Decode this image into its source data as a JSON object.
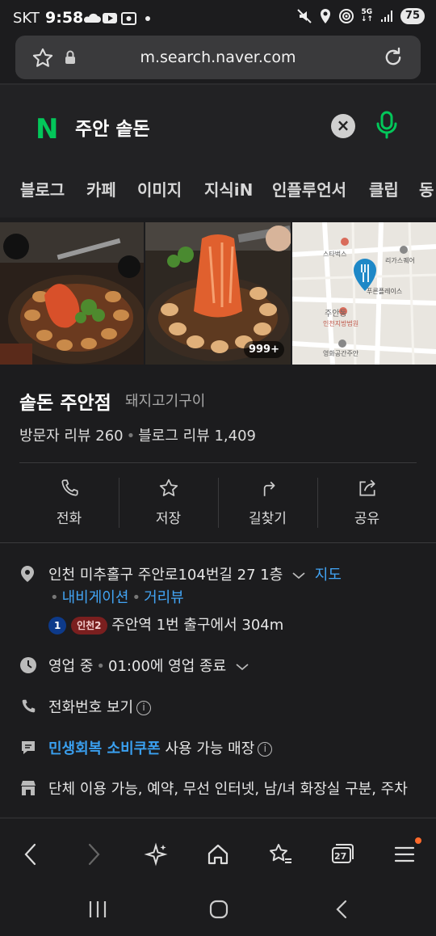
{
  "status_bar": {
    "carrier": "SKT",
    "time": "9:58",
    "battery": "75",
    "network": "5G"
  },
  "browser": {
    "url": "m.search.naver.com"
  },
  "search": {
    "logo": "N",
    "query": "주안 솥돈"
  },
  "tabs": [
    "블로그",
    "카페",
    "이미지",
    "지식iN",
    "인플루언서",
    "클립",
    "동"
  ],
  "gallery": {
    "more_count": "999+",
    "map_labels": [
      "스타벅스",
      "리가스퀘어",
      "주안동",
      "인천지방법원",
      "영화공간주안",
      "푸른플레이스"
    ]
  },
  "place": {
    "name": "솥돈 주안점",
    "category": "돼지고기구이",
    "visitor_reviews": "방문자 리뷰 260",
    "blog_reviews": "블로그 리뷰 1,409"
  },
  "actions": [
    {
      "label": "전화",
      "icon": "phone-icon"
    },
    {
      "label": "저장",
      "icon": "star-icon"
    },
    {
      "label": "길찾기",
      "icon": "direction-icon"
    },
    {
      "label": "공유",
      "icon": "share-icon"
    }
  ],
  "info": {
    "address": "인천 미추홀구 주안로104번길 27 1층",
    "map_link": "지도",
    "navigation_link": "내비게이션",
    "streetview_link": "거리뷰",
    "line1_badge": "1",
    "line2_badge": "인천2",
    "station_text": "주안역 1번 출구에서 304m",
    "hours_status": "영업 중",
    "hours_detail": "01:00에 영업 종료",
    "phone_text": "전화번호 보기",
    "coupon_highlight": "민생회복 소비쿠폰",
    "coupon_rest": "사용 가능 매장",
    "amenities": "단체 이용 가능, 예약, 무선 인터넷, 남/녀 화장실 구분, 주차"
  },
  "toolbar": {
    "tab_count": "27"
  },
  "colors": {
    "naver_green": "#03c75a",
    "link_blue": "#42a5f5",
    "background": "#1c1c1e",
    "notification": "#ff6a2b"
  }
}
